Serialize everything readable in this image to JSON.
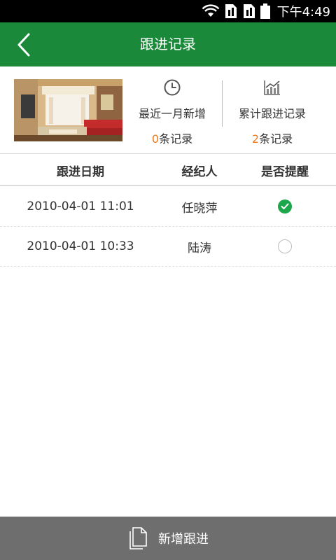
{
  "status_bar": {
    "time": "下午4:49",
    "icons": [
      "wifi-icon",
      "sim1-icon",
      "sim2-icon",
      "battery-icon"
    ]
  },
  "header": {
    "title": "跟进记录",
    "back_icon": "chevron-left-icon"
  },
  "summary": {
    "recent": {
      "icon": "clock-icon",
      "label": "最近一月新增",
      "count": "0",
      "unit": "条记录"
    },
    "total": {
      "icon": "chart-icon",
      "label": "累计跟进记录",
      "count": "2",
      "unit": "条记录"
    }
  },
  "table": {
    "headers": [
      "跟进日期",
      "经纪人",
      "是否提醒"
    ],
    "rows": [
      {
        "date": "2010-04-01 11:01",
        "agent": "任晓萍",
        "reminder": true
      },
      {
        "date": "2010-04-01 10:33",
        "agent": "陆涛",
        "reminder": false
      }
    ]
  },
  "footer": {
    "add_label": "新增跟进",
    "icon": "document-icon"
  },
  "colors": {
    "header_bg": "#1a8a3a",
    "accent_orange": "#f07a1c",
    "check_green": "#1ea64a",
    "footer_bg": "#6e6e6e"
  }
}
